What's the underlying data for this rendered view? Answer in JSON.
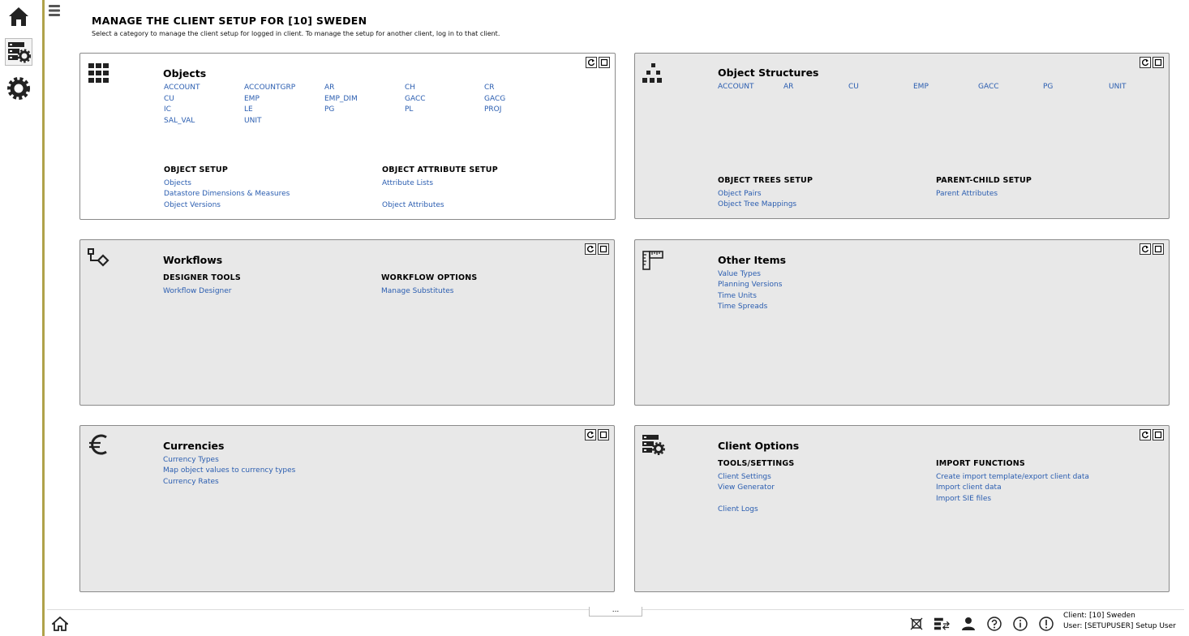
{
  "header": {
    "title": "MANAGE THE CLIENT SETUP FOR [10] SWEDEN",
    "subtitle": "Select a category to manage the client setup for logged in client. To manage the setup for another client, log in to that client."
  },
  "rail": {
    "icons": [
      "home-icon",
      "client-setup-icon",
      "settings-gear-icon"
    ]
  },
  "panels": {
    "objects": {
      "title": "Objects",
      "links": [
        "ACCOUNT",
        "ACCOUNTGRP",
        "AR",
        "CH",
        "CR",
        "CU",
        "EMP",
        "EMP_DIM",
        "GACC",
        "GACG",
        "IC",
        "LE",
        "PG",
        "PL",
        "PROJ",
        "SAL_VAL",
        "UNIT"
      ],
      "section1": {
        "heading": "OBJECT SETUP",
        "links": [
          "Objects",
          "Datastore Dimensions & Measures",
          "Object Versions"
        ]
      },
      "section2": {
        "heading": "OBJECT ATTRIBUTE SETUP",
        "links": [
          "Attribute Lists",
          "Object Attributes"
        ]
      }
    },
    "object_structures": {
      "title": "Object Structures",
      "links": [
        "ACCOUNT",
        "AR",
        "CU",
        "EMP",
        "GACC",
        "PG",
        "UNIT"
      ],
      "section1": {
        "heading": "OBJECT TREES SETUP",
        "links": [
          "Object Pairs",
          "Object Tree Mappings"
        ]
      },
      "section2": {
        "heading": "PARENT-CHILD SETUP",
        "links": [
          "Parent Attributes"
        ]
      }
    },
    "workflows": {
      "title": "Workflows",
      "section1": {
        "heading": "DESIGNER TOOLS",
        "links": [
          "Workflow Designer"
        ]
      },
      "section2": {
        "heading": "WORKFLOW OPTIONS",
        "links": [
          "Manage Substitutes"
        ]
      }
    },
    "other_items": {
      "title": "Other Items",
      "links": [
        "Value Types",
        "Planning Versions",
        "Time Units",
        "Time Spreads"
      ]
    },
    "currencies": {
      "title": "Currencies",
      "links": [
        "Currency Types",
        "Map object values to currency types",
        "Currency Rates"
      ]
    },
    "client_options": {
      "title": "Client Options",
      "section1": {
        "heading": "TOOLS/SETTINGS",
        "links": [
          "Client Settings",
          "View Generator",
          "Client Logs"
        ]
      },
      "section2": {
        "heading": "IMPORT FUNCTIONS",
        "links": [
          "Create import template/export client data",
          "Import client data",
          "Import SIE files"
        ]
      }
    }
  },
  "footer": {
    "more": "...",
    "client": "Client: [10] Sweden",
    "user": "User: [SETUPUSER] Setup User"
  },
  "colors": {
    "accent_line": "#b0a24a",
    "link": "#2a5db0",
    "panel_bg": "#e8e8e8"
  }
}
